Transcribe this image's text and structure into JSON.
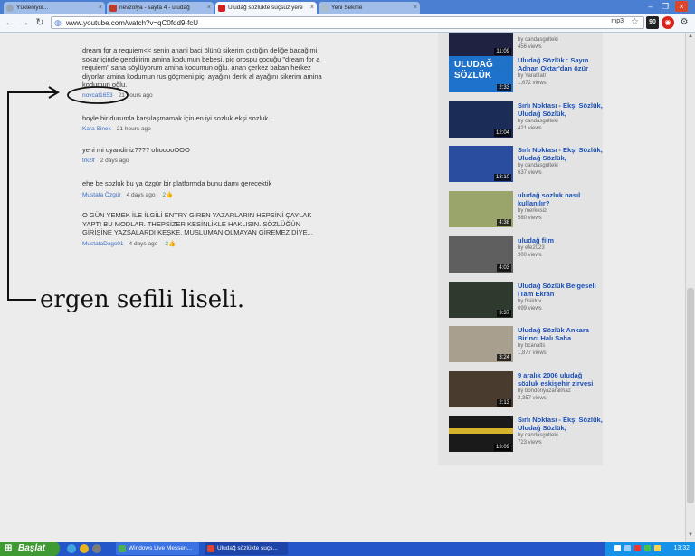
{
  "browser": {
    "tabs": [
      {
        "label": "Yükleniyor...",
        "favicon_color": "#9aa6b8"
      },
      {
        "label": "nevzolya - sayfa 4 - uludağ",
        "favicon_color": "#c0392b"
      },
      {
        "label": "Uludağ sözlükte suçsuz yere",
        "favicon_color": "#d41f1f"
      },
      {
        "label": "Yeni Sekme",
        "favicon_color": "#aabbcc"
      }
    ],
    "url": "www.youtube.com/watch?v=qC0fdd9-fcU",
    "mp3_label": "mp3",
    "ext_badge": "90"
  },
  "comments": [
    {
      "text": "dream for a requiem<< senin anani baci ölünü sikerim çıktığın deliğe bacağimi sokar içinde gezdiririm amina kodumun bebesi. piç orospu çocuğu \"dream for a requiem\" sana söylüyorum amina kodumun oğlu. anan çerkez baban herkez diyorlar amina kodumun rus göçmeni piç. ayağını denk al ayağını sikerim amina kodumun oğlu.",
      "author": "novcat1653",
      "time": "21 hours ago",
      "votes": ""
    },
    {
      "text": "boyle bir durumla karşılaşmamak için en iyi sozluk ekşi sozluk.",
      "author": "Kara Sinek",
      "time": "21 hours ago",
      "votes": ""
    },
    {
      "text": "yeni mi uyandiniz???? ohooooOOO",
      "author": "trkzlf",
      "time": "2 days ago",
      "votes": ""
    },
    {
      "text": "ehe be sozluk bu ya özgür bir platformda bunu damı gerecektik",
      "author": "Mustafa Özgür",
      "time": "4 days ago",
      "votes": "2"
    },
    {
      "text": "O GÜN YEMEK İLE İLGİLİ ENTRY GİREN YAZARLARIN HEPSİNİ ÇAYLAK YAPTI BU MODLAR. THEPSİZER KESİNLİKLE HAKLISIN. SÖZLÜĞÜN GİRİŞİNE YAZSALARDI KEŞKE, MUSLUMAN OLMAYAN GİREMEZ DİYE...",
      "author": "MustafaDagc01",
      "time": "4 days ago",
      "votes": "3"
    }
  ],
  "annotation": "ergen sefili liseli.",
  "related": [
    {
      "title": "",
      "by": "by candasgulteki",
      "views": "456 views",
      "duration": "11:09",
      "thumb_color": "#1d2340"
    },
    {
      "title": "Uludağ Sözlük : Sayın Adnan Oktar'dan özür",
      "by": "by Yaratilatr",
      "views": "1,672 views",
      "duration": "2:33",
      "thumb_color": "#1f72c9",
      "thumb_text": "ULUDAĞ SÖZLÜK"
    },
    {
      "title": "Sırlı Noktası - Ekşi Sözlük, Uludağ Sözlük,",
      "by": "by candasgulteki",
      "views": "421 views",
      "duration": "12:04",
      "thumb_color": "#1b2c57"
    },
    {
      "title": "Sırlı Noktası - Ekşi Sözlük, Uludağ Sözlük,",
      "by": "by candasgulteki",
      "views": "637 views",
      "duration": "13:10",
      "thumb_color": "#2b4da0"
    },
    {
      "title": "uludağ sozluk nasıl kullanılır?",
      "by": "by merkesiz",
      "views": "580 views",
      "duration": "4:38",
      "thumb_color": "#9aa56b"
    },
    {
      "title": "uludağ film",
      "by": "by efe2023",
      "views": "300 views",
      "duration": "4:03",
      "thumb_color": "#5f5f5f"
    },
    {
      "title": "Uludağ Sözlük Belgeseli (Tam Ekran",
      "by": "by fisildov",
      "views": "099 views",
      "duration": "3:37",
      "thumb_color": "#2e3a2e"
    },
    {
      "title": "Uludağ Sözlük Ankara Birinci Halı Saha",
      "by": "by bcanalts",
      "views": "1,877 views",
      "duration": "3:24",
      "thumb_color": "#a89f8e"
    },
    {
      "title": "9 aralık 2006 uludağ sözluk eskişehir zirvesi",
      "by": "by bondonyazaralmaz",
      "views": "2,357 views",
      "duration": "2:13",
      "thumb_color": "#4a3b2f"
    },
    {
      "title": "Sırlı Noktası - Ekşi Sözlük, Uludağ Sözlük,",
      "by": "by candasgulteki",
      "views": "723 views",
      "duration": "13:09",
      "thumb_color": "#1a1a1a"
    }
  ],
  "taskbar": {
    "start_label": "Başlat",
    "tasks": [
      {
        "label": "Windows Live Messen...",
        "icon_color": "#4caf50",
        "active": false
      },
      {
        "label": "Uludağ sözlükte suçs...",
        "icon_color": "#e0452f",
        "active": true
      }
    ],
    "clock": "13:32"
  }
}
